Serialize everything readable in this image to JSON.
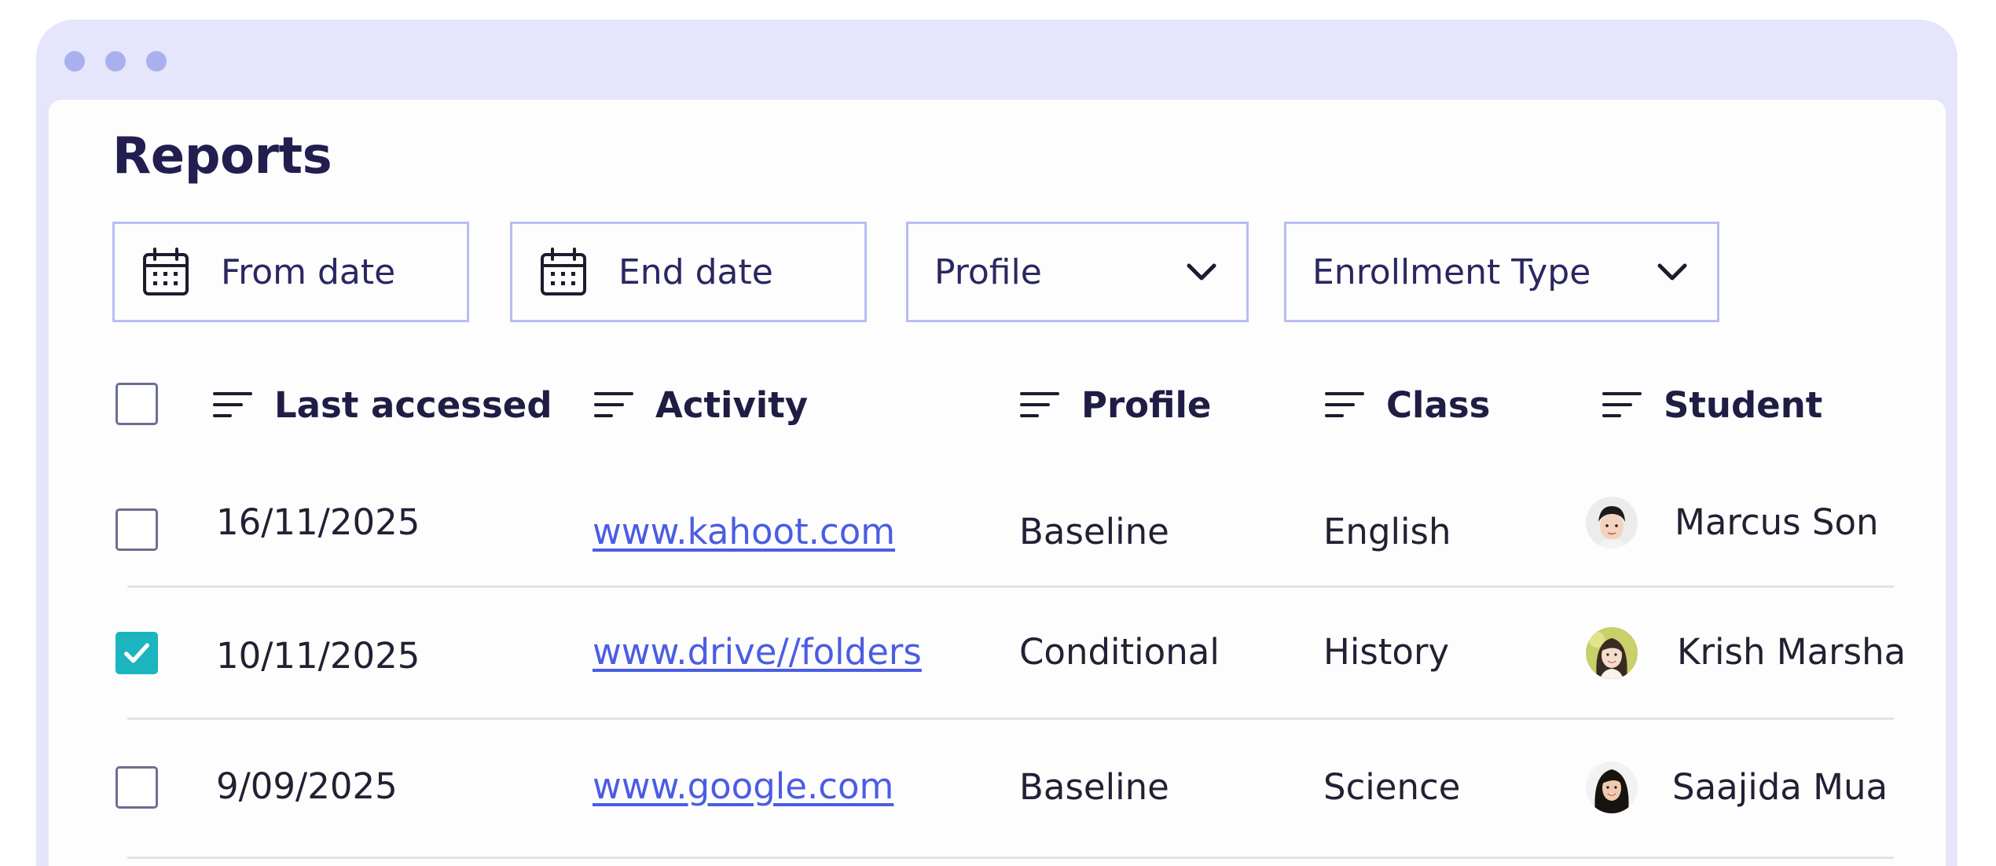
{
  "page": {
    "title": "Reports"
  },
  "filters": {
    "from_date": "From date",
    "end_date": "End date",
    "profile": "Profile",
    "enrollment_type": "Enrollment Type"
  },
  "table": {
    "columns": [
      "Last accessed",
      "Activity",
      "Profile",
      "Class",
      "Student"
    ],
    "rows": [
      {
        "checked": false,
        "last_accessed": "16/11/2025",
        "activity": "www.kahoot.com",
        "profile": "Baseline",
        "class": "English",
        "student": "Marcus Son"
      },
      {
        "checked": true,
        "last_accessed": "10/11/2025",
        "activity": "www.drive//folders",
        "profile": "Conditional",
        "class": "History",
        "student": "Krish Marsha"
      },
      {
        "checked": false,
        "last_accessed": "9/09/2025",
        "activity": "www.google.com",
        "profile": "Baseline",
        "class": "Science",
        "student": "Saajida Mua"
      }
    ]
  },
  "icons": {
    "calendar": "calendar-icon",
    "chevron": "chevron-down-icon",
    "sort": "sort-icon",
    "check": "checkmark-icon"
  },
  "colors": {
    "window_frame": "#e5e6fc",
    "accent_border": "#b8bdf1",
    "link": "#4b5ce4",
    "checked": "#1bb4bf",
    "title": "#221e50"
  }
}
